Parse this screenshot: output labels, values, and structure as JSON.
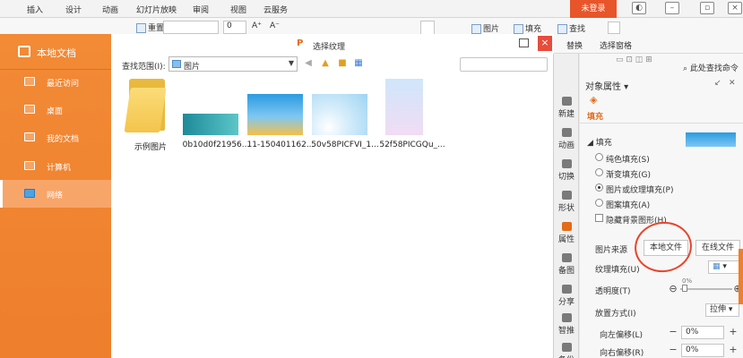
{
  "ribbon_tabs": [
    "插入",
    "设计",
    "动画",
    "幻灯片放映",
    "审阅",
    "视图",
    "云服务"
  ],
  "window": {
    "login_label": "未登录"
  },
  "ribbon": {
    "reset_label": "重置",
    "font_size_value": "0",
    "grow_label": "A⁺",
    "shrink_label": "A⁻",
    "shape_label": "图片",
    "fill_label": "填充",
    "find_label": "查找",
    "replace_label": "替换",
    "select_pane_label": "选择窗格",
    "object_select_label": "选择"
  },
  "sidebar": {
    "title": "本地文档",
    "items": [
      {
        "label": "最近访问",
        "icon": "recent-icon",
        "active": false
      },
      {
        "label": "桌面",
        "icon": "desktop-icon",
        "active": false
      },
      {
        "label": "我的文档",
        "icon": "folder-icon",
        "active": false
      },
      {
        "label": "计算机",
        "icon": "computer-icon",
        "active": false
      },
      {
        "label": "网络",
        "icon": "network-icon",
        "active": true
      }
    ]
  },
  "dialog": {
    "title": "选择纹理",
    "lookin_label": "查找范围(I):",
    "lookin_value": "图片",
    "search_placeholder": "",
    "files": [
      {
        "name": "示例图片",
        "kind": "folder"
      },
      {
        "name": "0b10d0f21956...",
        "kind": "image",
        "colors": [
          "#1e8a9a",
          "#5cc6c8"
        ]
      },
      {
        "name": "11-150401162...",
        "kind": "image",
        "colors": [
          "#2b9be0",
          "#f5c04a"
        ]
      },
      {
        "name": "50v58PICFVI_1...",
        "kind": "image",
        "colors": [
          "#9ed4f3",
          "#d9eefb"
        ]
      },
      {
        "name": "52f58PICGQu_...",
        "kind": "image",
        "colors": [
          "#cfe6fb",
          "#f1dcf4"
        ]
      }
    ]
  },
  "task_tabs": [
    {
      "label": "新建",
      "selected": false
    },
    {
      "label": "动画",
      "selected": false
    },
    {
      "label": "切换",
      "selected": false
    },
    {
      "label": "形状",
      "selected": false
    },
    {
      "label": "属性",
      "selected": true
    },
    {
      "label": "备图",
      "selected": false
    },
    {
      "label": "分享",
      "selected": false
    },
    {
      "label": "智推",
      "selected": false
    },
    {
      "label": "备份",
      "selected": false
    }
  ],
  "panel": {
    "search_label": "此处查找命令",
    "title": "对象属性",
    "tab_label": "填充",
    "section_label": "填充",
    "fill_options": [
      {
        "label": "纯色填充(S)",
        "selected": false
      },
      {
        "label": "渐变填充(G)",
        "selected": false
      },
      {
        "label": "图片或纹理填充(P)",
        "selected": true
      },
      {
        "label": "图案填充(A)",
        "selected": false
      }
    ],
    "hide_bg_label": "隐藏背景图形(H)",
    "source_label": "图片来源",
    "local_file_label": "本地文件",
    "online_file_label": "在线文件",
    "texture_label": "纹理填充(U)",
    "transparency_label": "透明度(T)",
    "transparency_value": "0%",
    "tiling_label": "放置方式(I)",
    "tiling_value": "拉伸",
    "offset_left_label": "向左偏移(L)",
    "offset_left_value": "0%",
    "offset_right_label": "向右偏移(R)",
    "offset_right_value": "0%"
  },
  "colors": {
    "accent": "#ee7f2c",
    "highlight_circle": "#e8452c"
  }
}
